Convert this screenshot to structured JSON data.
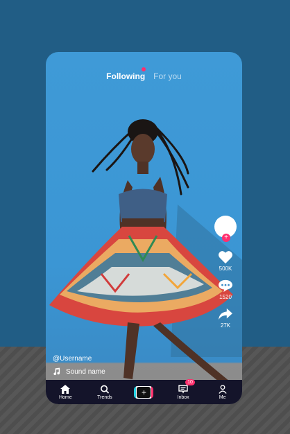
{
  "tabs": {
    "following": "Following",
    "for_you": "For you"
  },
  "rail": {
    "likes": "500K",
    "comments": "1520",
    "shares": "27K"
  },
  "caption": {
    "username": "@Username",
    "sound": "Sound name"
  },
  "nav": {
    "home": "Home",
    "trends": "Trends",
    "inbox": "Inbox",
    "inbox_badge": "10",
    "me": "Me",
    "create_symbol": "+"
  },
  "colors": {
    "accent": "#ff2f6d",
    "cyan": "#29d7e8",
    "nav_bg": "#14142a",
    "sky": "#3f9ad7"
  },
  "icons": [
    "heart-icon",
    "comment-icon",
    "share-icon",
    "music-note-icon",
    "home-icon",
    "search-icon",
    "inbox-icon",
    "person-icon"
  ]
}
